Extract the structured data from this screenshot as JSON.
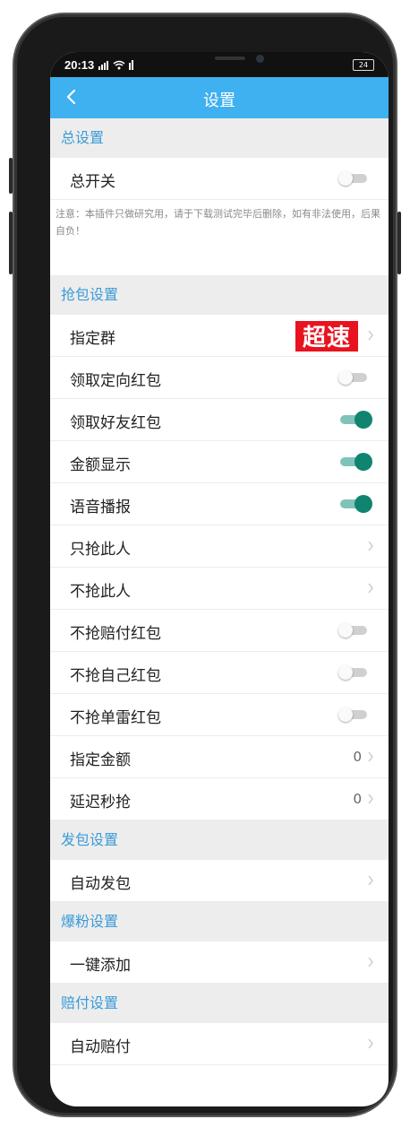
{
  "status": {
    "time": "20:13",
    "signal": "4G",
    "battery": "24"
  },
  "nav": {
    "title": "设置"
  },
  "sections": [
    {
      "header": "总设置"
    },
    {
      "header": "抢包设置"
    },
    {
      "header": "发包设置"
    },
    {
      "header": "爆粉设置"
    },
    {
      "header": "赔付设置"
    }
  ],
  "general": {
    "master_switch": {
      "label": "总开关",
      "on": false
    },
    "notice": "注意：本插件只做研究用，请于下载测试完毕后删除，如有非法使用，后果自负！"
  },
  "grab": {
    "items": [
      {
        "label": "指定群",
        "type": "link"
      },
      {
        "label": "领取定向红包",
        "type": "toggle",
        "on": false
      },
      {
        "label": "领取好友红包",
        "type": "toggle",
        "on": true
      },
      {
        "label": "金额显示",
        "type": "toggle",
        "on": true
      },
      {
        "label": "语音播报",
        "type": "toggle",
        "on": true
      },
      {
        "label": "只抢此人",
        "type": "link"
      },
      {
        "label": "不抢此人",
        "type": "link"
      },
      {
        "label": "不抢赔付红包",
        "type": "toggle",
        "on": false
      },
      {
        "label": "不抢自己红包",
        "type": "toggle",
        "on": false
      },
      {
        "label": "不抢单雷红包",
        "type": "toggle",
        "on": false
      },
      {
        "label": "指定金额",
        "type": "value",
        "value": "0"
      },
      {
        "label": "延迟秒抢",
        "type": "value",
        "value": "0"
      }
    ],
    "badge": "超速"
  },
  "send": {
    "items": [
      {
        "label": "自动发包",
        "type": "link"
      }
    ]
  },
  "fans": {
    "items": [
      {
        "label": "一键添加",
        "type": "link"
      }
    ]
  },
  "pay": {
    "items": [
      {
        "label": "自动赔付",
        "type": "link"
      }
    ]
  },
  "colors": {
    "accent": "#3fb0f0",
    "toggle_on": "#11846f",
    "section_text": "#3a9bd8",
    "badge": "#e8131f"
  }
}
